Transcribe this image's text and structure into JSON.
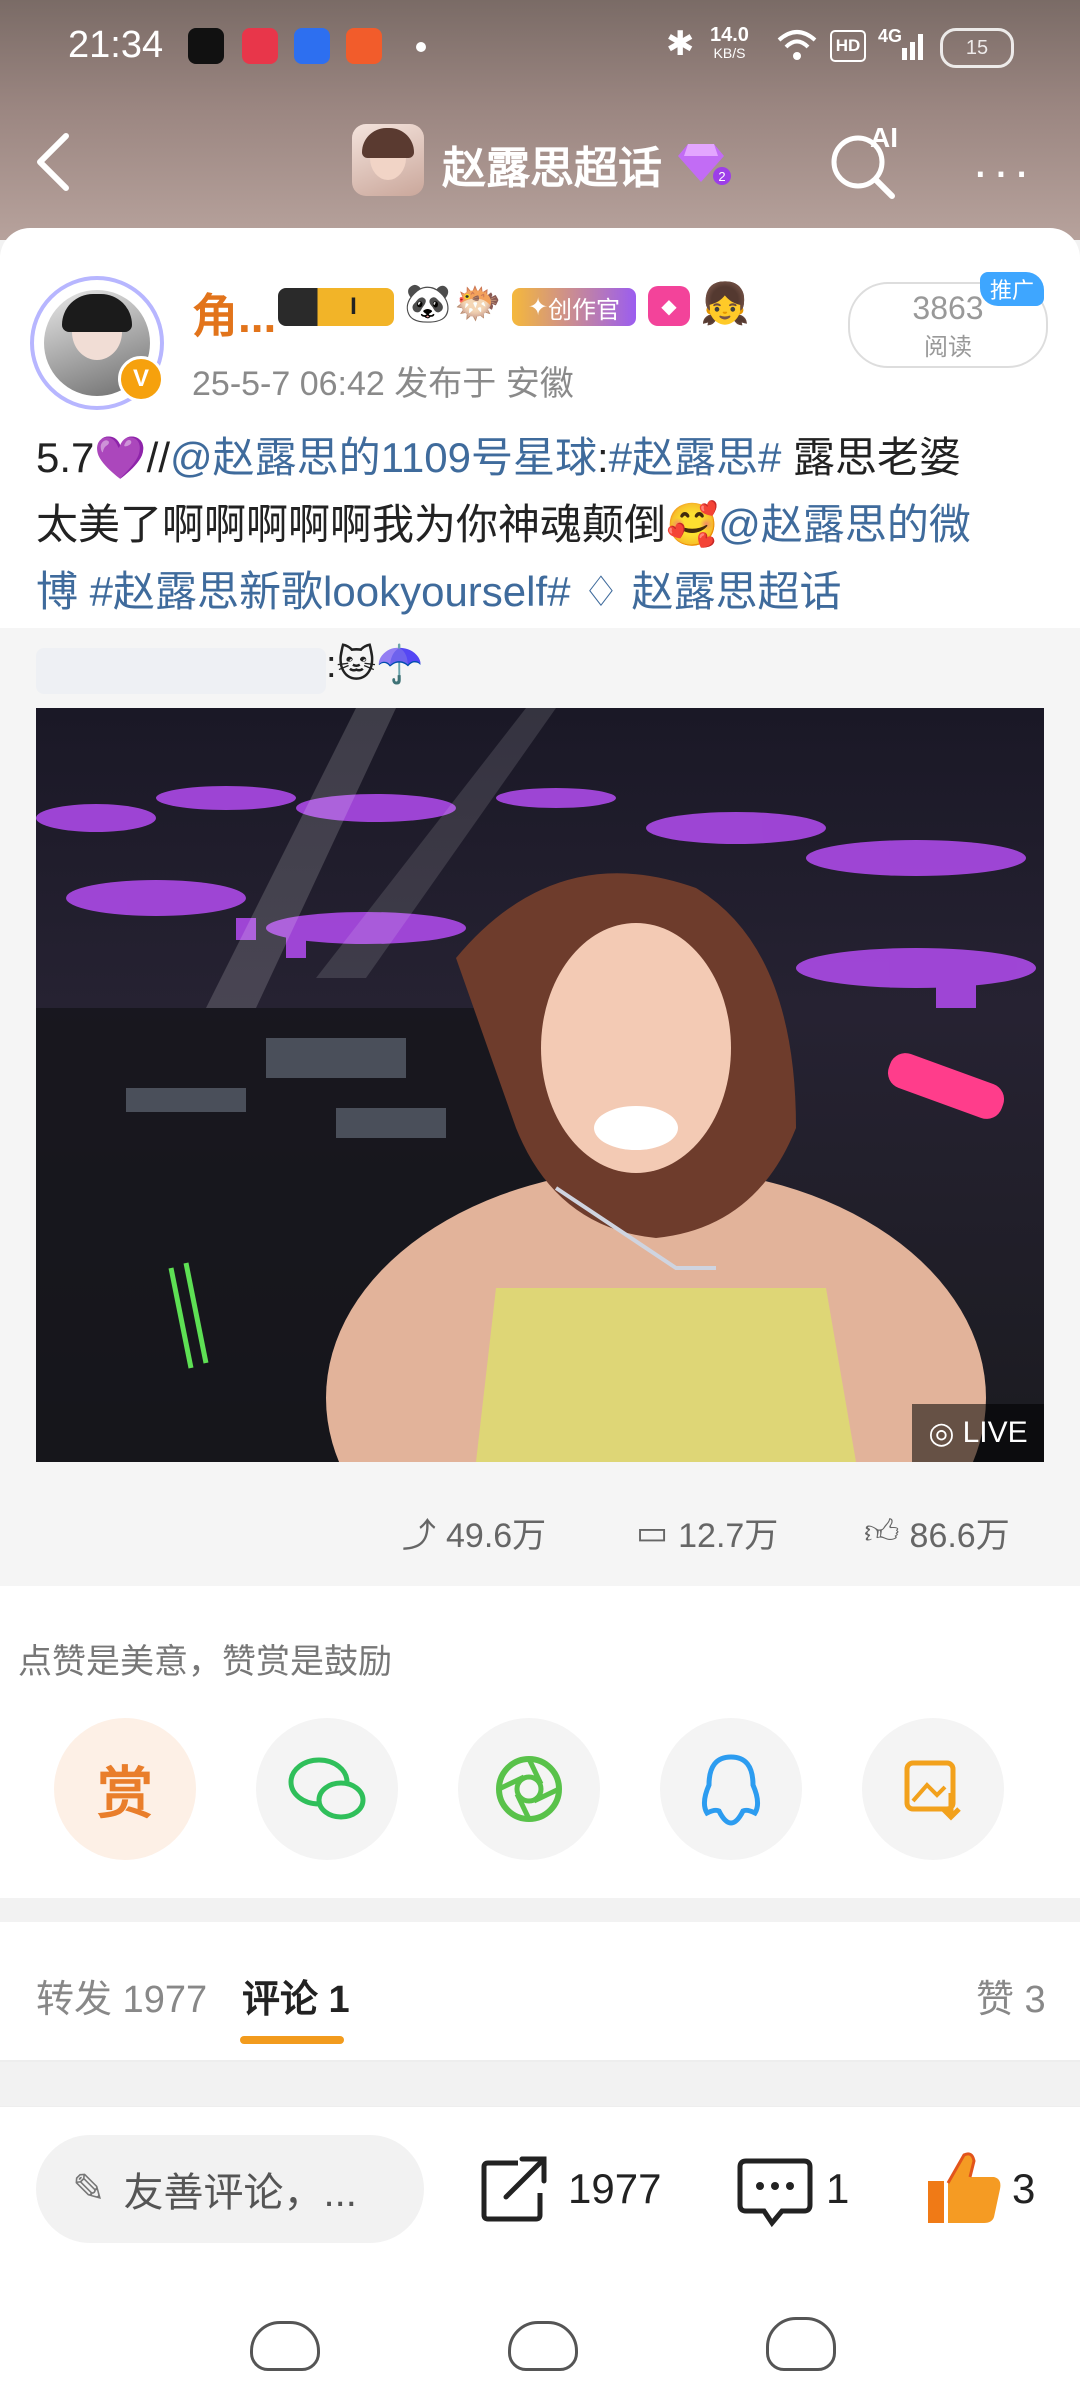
{
  "status_bar": {
    "time": "21:34",
    "net_speed_value": "14.0",
    "net_speed_unit": "KB/S",
    "hd_label": "HD",
    "network_label": "4G",
    "battery_level": "15"
  },
  "nav": {
    "title": "赵露思超话",
    "ai_label": "AI"
  },
  "post": {
    "user_name": "角...",
    "creator_badge": "创作官",
    "date_location": "25-5-7 06:42  发布于 安徽",
    "read_count": "3863",
    "read_label": "阅读",
    "promo_tag": "推广",
    "line1_a": "5.7💜//",
    "line1_mention": "@赵露思的1109号星球",
    "line1_colon": ":",
    "line1_topic": "#赵露思#",
    "line1_b": " 露思老婆",
    "line2_a": "太美了啊啊啊啊啊我为你神魂颠倒🥰",
    "line2_mention": "@赵露思的微",
    "line3_a": "博",
    "line3_topic": " #赵露思新歌lookyourself#",
    "line3_supertopic": " 赵露思超话"
  },
  "repost": {
    "colon_emoji": ":🐱☂️",
    "live_label": "LIVE",
    "forward_count": "49.6万",
    "comment_count": "12.7万",
    "like_count": "86.6万"
  },
  "share": {
    "hint": "点赞是美意，赞赏是鼓励",
    "reward_label": "赏"
  },
  "tabs": {
    "forward": "转发 1977",
    "comment": "评论 1",
    "like": "赞 3"
  },
  "bottom": {
    "input_placeholder": "友善评论，...",
    "forward_count": "1977",
    "comment_count": "1",
    "like_count": "3"
  },
  "colors": {
    "accent_orange": "#e2741b",
    "link_blue": "#3f6b9c"
  }
}
